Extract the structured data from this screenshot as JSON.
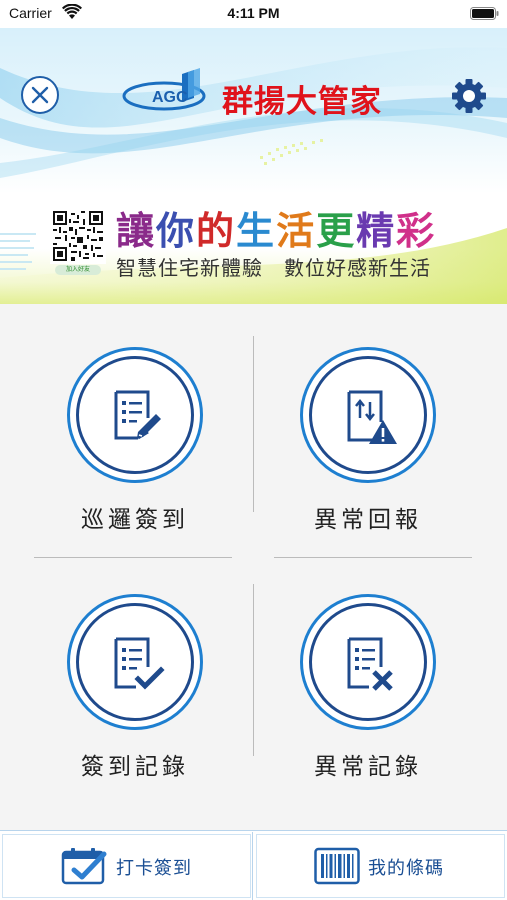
{
  "status_bar": {
    "carrier": "Carrier",
    "time": "4:11 PM"
  },
  "header": {
    "logo_text": "AGC",
    "brand_title": "群揚大管家"
  },
  "banner": {
    "slogan": [
      "讓",
      "你",
      "的",
      "生",
      "活",
      "更",
      "精",
      "彩"
    ],
    "slogan_colors": [
      "#8a2a8a",
      "#3b4fb0",
      "#d02a2a",
      "#2a8ad0",
      "#e07a1a",
      "#2aa04a",
      "#6a3ab0",
      "#d0308a"
    ],
    "subslogan": "智慧住宅新體驗　數位好感新生活",
    "qr_label": "加入好友"
  },
  "tiles": [
    {
      "label": "巡邏簽到",
      "icon": "patrol-sign-icon"
    },
    {
      "label": "異常回報",
      "icon": "anomaly-report-icon"
    },
    {
      "label": "簽到記錄",
      "icon": "sign-record-icon"
    },
    {
      "label": "異常記錄",
      "icon": "anomaly-record-icon"
    }
  ],
  "bottom_bar": {
    "checkin_label": "打卡簽到",
    "barcode_label": "我的條碼"
  },
  "colors": {
    "brand_red": "#e0131b",
    "primary_blue": "#1f4a8c",
    "accent_blue": "#1e7fd0"
  }
}
